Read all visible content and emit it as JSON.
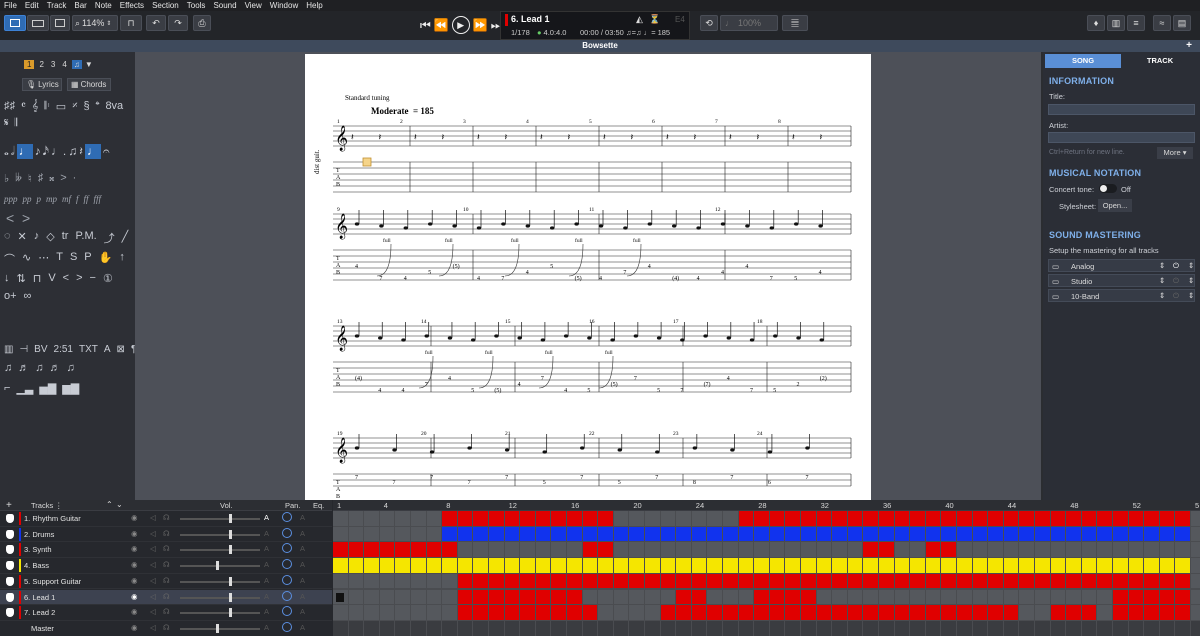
{
  "menu": [
    "File",
    "Edit",
    "Track",
    "Bar",
    "Note",
    "Effects",
    "Section",
    "Tools",
    "Sound",
    "View",
    "Window",
    "Help"
  ],
  "toolbar": {
    "zoom": "114%",
    "track_title": "6. Lead 1",
    "bar_pos": "1/178",
    "time_sig": "4.0:4.0",
    "time": "00:00 / 03:50",
    "tempo": "185",
    "note_name": "E4",
    "speed": "100%"
  },
  "score_title": "Bowsette",
  "left_panel": {
    "pages": [
      "1",
      "2",
      "3",
      "4"
    ],
    "lyrics": "Lyrics",
    "chords": "Chords"
  },
  "score": {
    "tuning": "Standard tuning",
    "tempo_text": "Moderate",
    "tempo_value": "= 185",
    "track_label": "dist guit.",
    "bend": "full",
    "bar_numbers_1": [
      "1",
      "2",
      "3",
      "4",
      "5",
      "6",
      "7",
      "8"
    ],
    "bar_numbers_2": [
      "9",
      "10",
      "11",
      "12"
    ],
    "bar_numbers_3": [
      "13",
      "14",
      "15",
      "16",
      "17",
      "18"
    ],
    "bar_numbers_4": [
      "19",
      "20",
      "21",
      "22",
      "23",
      "24"
    ],
    "tab_row2": [
      "4",
      "7",
      "4",
      "5",
      "(5)",
      "4",
      "7",
      "4",
      "5",
      "(5)",
      "4",
      "7",
      "4",
      "(4)",
      "4",
      "4",
      "4",
      "7",
      "5",
      "4"
    ],
    "tab_row3": [
      "(4)",
      "4",
      "4",
      "7",
      "4",
      "5",
      "(5)",
      "4",
      "7",
      "4",
      "5",
      "(5)",
      "7",
      "5",
      "7",
      "(7)",
      "4",
      "7",
      "5",
      "2",
      "(2)"
    ],
    "tab_row4": [
      "7",
      "7",
      "7",
      "7",
      "7",
      "5",
      "7",
      "5",
      "7",
      "8",
      "7",
      "6",
      "7"
    ]
  },
  "right_panel": {
    "tab_song": "SONG",
    "tab_track": "TRACK",
    "info_title": "INFORMATION",
    "title_label": "Title:",
    "artist_label": "Artist:",
    "hint": "Ctrl+Return for new line.",
    "more": "More ▾",
    "notation_title": "MUSICAL NOTATION",
    "concert_tone": "Concert tone:",
    "concert_off": "Off",
    "stylesheet": "Stylesheet:",
    "open": "Open...",
    "mastering_title": "SOUND MASTERING",
    "mastering_sub": "Setup the mastering for all tracks",
    "presets": [
      "Analog",
      "Studio",
      "10-Band"
    ]
  },
  "tracks_header": {
    "tracks": "Tracks",
    "vol": "Vol.",
    "pan": "Pan.",
    "eq": "Eq."
  },
  "tracks": [
    {
      "name": "1. Rhythm Guitar",
      "color": "#e00000"
    },
    {
      "name": "2. Drums",
      "color": "#1133ee"
    },
    {
      "name": "3. Synth",
      "color": "#e00000"
    },
    {
      "name": "4. Bass",
      "color": "#f5e600"
    },
    {
      "name": "5. Support Guitar",
      "color": "#e00000"
    },
    {
      "name": "6. Lead 1",
      "color": "#e00000"
    },
    {
      "name": "7. Lead 2",
      "color": "#e00000"
    },
    {
      "name": "Master",
      "color": ""
    }
  ],
  "ruler_labels": [
    "1",
    "4",
    "8",
    "12",
    "16",
    "20",
    "24",
    "28",
    "32",
    "36",
    "40",
    "44",
    "48",
    "52",
    "5"
  ],
  "track_blocks": [
    [
      [
        7,
        18
      ],
      [
        26,
        55
      ]
    ],
    [
      [
        7,
        55
      ]
    ],
    [
      [
        0,
        8
      ],
      [
        16,
        18
      ],
      [
        34,
        36
      ],
      [
        38,
        40
      ]
    ],
    [
      [
        0,
        55
      ]
    ],
    [
      [
        8,
        55
      ]
    ],
    [
      [
        8,
        16
      ],
      [
        22,
        24
      ],
      [
        27,
        31
      ],
      [
        50,
        55
      ]
    ],
    [
      [
        8,
        17
      ],
      [
        21,
        44
      ],
      [
        46,
        49
      ],
      [
        50,
        55
      ]
    ]
  ],
  "accent": "#2f6cb4"
}
